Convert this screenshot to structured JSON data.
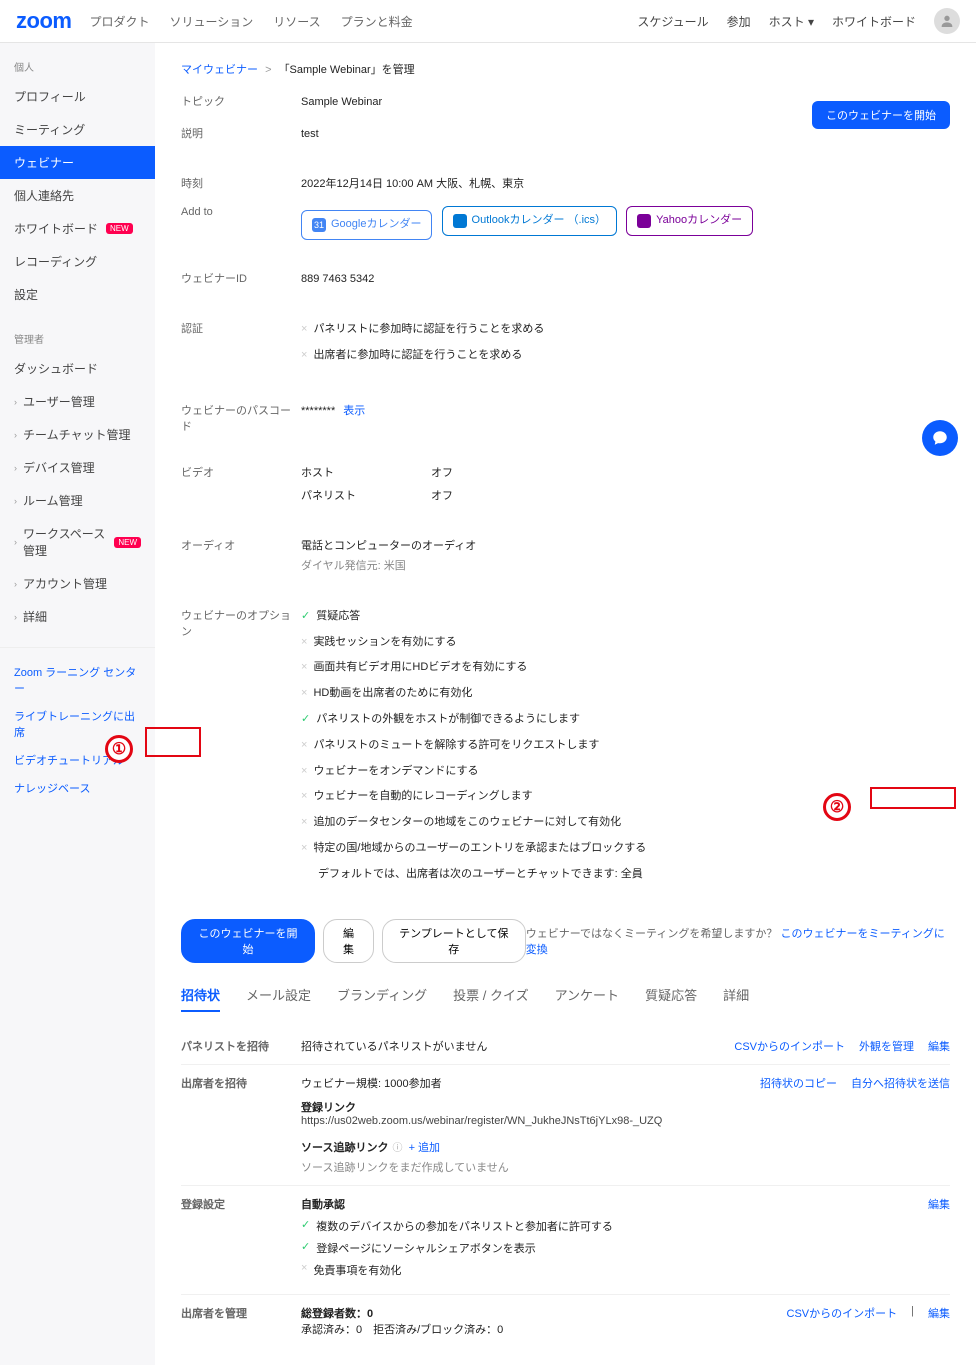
{
  "brand": "zoom",
  "topnav": {
    "product": "プロダクト",
    "solution": "ソリューション",
    "resource": "リソース",
    "plan": "プランと料金"
  },
  "toplinks": {
    "schedule": "スケジュール",
    "join": "参加",
    "host": "ホスト",
    "whiteboard": "ホワイトボード"
  },
  "sidebar": {
    "section_personal": "個人",
    "profile": "プロフィール",
    "meeting": "ミーティング",
    "webinar": "ウェビナー",
    "contacts": "個人連絡先",
    "whiteboard": "ホワイトボード",
    "recording": "レコーディング",
    "settings": "設定",
    "section_admin": "管理者",
    "dashboard": "ダッシュボード",
    "user_mgmt": "ユーザー管理",
    "teamchat_mgmt": "チームチャット管理",
    "device_mgmt": "デバイス管理",
    "room_mgmt": "ルーム管理",
    "workspace_mgmt": "ワークスペース管理",
    "account_mgmt": "アカウント管理",
    "advanced": "詳細",
    "new_badge": "NEW",
    "link_learning": "Zoom ラーニング センター",
    "link_live": "ライブトレーニングに出席",
    "link_video": "ビデオチュートリアル",
    "link_kb": "ナレッジベース"
  },
  "breadcrumb": {
    "root": "マイウェビナー",
    "sep": ">",
    "current": "「Sample Webinar」を管理"
  },
  "start_webinar_btn": "このウェビナーを開始",
  "info": {
    "topic_label": "トピック",
    "topic": "Sample Webinar",
    "desc_label": "説明",
    "desc": "test",
    "time_label": "時刻",
    "time": "2022年12月14日 10:00 AM 大阪、札幌、東京",
    "addto": "Add to",
    "google_cal": "Googleカレンダー",
    "outlook_cal": "Outlookカレンダー （.ics）",
    "yahoo_cal": "Yahooカレンダー",
    "id_label": "ウェビナーID",
    "id": "889 7463 5342",
    "auth_label": "認証",
    "auth1": "パネリストに参加時に認証を行うことを求める",
    "auth2": "出席者に参加時に認証を行うことを求める",
    "pass_label": "ウェビナーのパスコード",
    "pass_val": "********",
    "pass_show": "表示",
    "video_label": "ビデオ",
    "video_host": "ホスト",
    "video_panel": "パネリスト",
    "off": "オフ",
    "audio_label": "オーディオ",
    "audio_val": "電話とコンピューターのオーディオ",
    "dial_from": "ダイヤル発信元: 米国",
    "options_label": "ウェビナーのオプション",
    "opts": {
      "qa": "質疑応答",
      "practice": "実践セッションを有効にする",
      "hd": "画面共有ビデオ用にHDビデオを有効にする",
      "hd_attendee": "HD動画を出席者のために有効化",
      "panelist_view": "パネリストの外観をホストが制御できるようにします",
      "unmute": "パネリストのミュートを解除する許可をリクエストします",
      "ondemand": "ウェビナーをオンデマンドにする",
      "autorec": "ウェビナーを自動的にレコーディングします",
      "dc": "追加のデータセンターの地域をこのウェビナーに対して有効化",
      "region": "特定の国/地域からのユーザーのエントリを承認またはブロックする",
      "chat_default": "デフォルトでは、出席者は次のユーザーとチャットできます: 全員"
    }
  },
  "actions": {
    "start": "このウェビナーを開始",
    "edit": "編集",
    "save_template": "テンプレートとして保存",
    "convert_prompt": "ウェビナーではなくミーティングを希望しますか？",
    "convert_link": "このウェビナーをミーティングに変換"
  },
  "tabs": {
    "invitation": "招待状",
    "email": "メール設定",
    "branding": "ブランディング",
    "poll": "投票 / クイズ",
    "survey": "アンケート",
    "qa": "質疑応答",
    "more": "詳細"
  },
  "invite": {
    "panelist_label": "パネリストを招待",
    "panelist_none": "招待されているパネリストがいません",
    "csv_import": "CSVからのインポート",
    "manage_appearance": "外観を管理",
    "edit": "編集",
    "attendee_label": "出席者を招待",
    "capacity": "ウェビナー規模: 1000参加者",
    "copy_invite": "招待状のコピー",
    "send_self": "自分へ招待状を送信",
    "reg_link_label": "登録リンク",
    "reg_link": "https://us02web.zoom.us/webinar/register/WN_JukheJNsTt6jYLx98-_UZQ",
    "source_track_label": "ソース追跡リンク",
    "add": "+ 追加",
    "source_none": "ソース追跡リンクをまだ作成していません",
    "reg_set_label": "登録設定",
    "auto_approve": "自動承認",
    "reg_opt1": "複数のデバイスからの参加をパネリストと参加者に許可する",
    "reg_opt2": "登録ページにソーシャルシェアボタンを表示",
    "reg_opt3": "免責事項を有効化",
    "manage_attendee_label": "出席者を管理",
    "total_reg": "総登録者数：0",
    "approve_stats": "承認済み：0　拒否済み/ブロック済み：0",
    "csv_import2": "CSVからのインポート"
  }
}
